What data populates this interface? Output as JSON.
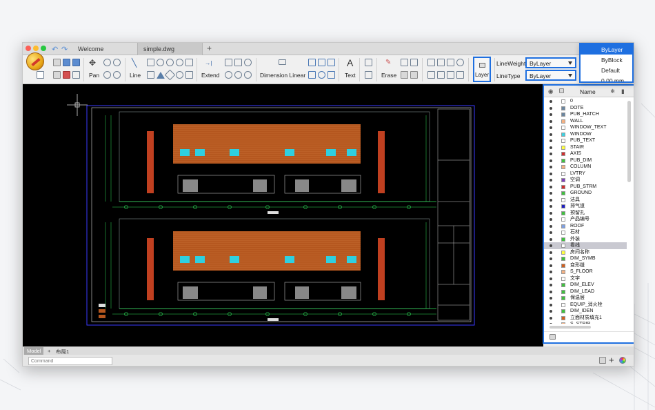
{
  "tabs": [
    {
      "label": "Welcome"
    },
    {
      "label": "simple.dwg"
    }
  ],
  "tab_add": "+",
  "ribbon": {
    "pan": "Pan",
    "line": "Line",
    "extend": "Extend",
    "dimension": "Dimension Linear",
    "text": "Text",
    "erase": "Erase",
    "layer": "Layer",
    "lineweight_label": "LineWeight",
    "linetype_label": "LineType",
    "lineweight_value": "ByLayer",
    "linetype_value": "ByLayer"
  },
  "dropdown": {
    "items": [
      "ByLayer",
      "ByBlock",
      "Default",
      "0.00 mm"
    ],
    "selected": "ByLayer"
  },
  "panel": {
    "name_header": "Name",
    "layers": [
      {
        "name": "0",
        "color": "#ffffff"
      },
      {
        "name": "DOTE",
        "color": "#6b86a0"
      },
      {
        "name": "PUB_HATCH",
        "color": "#6b86a0"
      },
      {
        "name": "WALL",
        "color": "#f4b183"
      },
      {
        "name": "WINDOW_TEXT",
        "color": "#ffffff"
      },
      {
        "name": "WINDOW",
        "color": "#40d0e0"
      },
      {
        "name": "PUB_TEXT",
        "color": "#ffffff"
      },
      {
        "name": "STAIR",
        "color": "#ffff40"
      },
      {
        "name": "AXIS",
        "color": "#d03030"
      },
      {
        "name": "PUB_DIM",
        "color": "#40c040"
      },
      {
        "name": "COLUMN",
        "color": "#f4b183"
      },
      {
        "name": "LVTRY",
        "color": "#ffffff"
      },
      {
        "name": "空调",
        "color": "#8040c0"
      },
      {
        "name": "PUB_STRM",
        "color": "#d03030"
      },
      {
        "name": "GROUND",
        "color": "#40c040"
      },
      {
        "name": "洁具",
        "color": "#ffffff"
      },
      {
        "name": "排气道",
        "color": "#2020c0"
      },
      {
        "name": "预留孔",
        "color": "#40c040"
      },
      {
        "name": "产品编号",
        "color": "#ffffff"
      },
      {
        "name": "ROOF",
        "color": "#80a0e0"
      },
      {
        "name": "石材",
        "color": "#ffffff"
      },
      {
        "name": "外装",
        "color": "#40c040"
      },
      {
        "name": "看线",
        "color": "#ffffff"
      },
      {
        "name": "房间名称",
        "color": "#ffff40"
      },
      {
        "name": "DIM_SYMB",
        "color": "#40c040"
      },
      {
        "name": "变形缝",
        "color": "#d06020"
      },
      {
        "name": "S_FLOOR",
        "color": "#f4b183"
      },
      {
        "name": "文字",
        "color": "#ffffff"
      },
      {
        "name": "DIM_ELEV",
        "color": "#40c040"
      },
      {
        "name": "DIM_LEAD",
        "color": "#40c040"
      },
      {
        "name": "保温层",
        "color": "#40c040"
      },
      {
        "name": "EQUIP_消火栓",
        "color": "#ffffff"
      },
      {
        "name": "DIM_IDEN",
        "color": "#40c040"
      },
      {
        "name": "立面材质填充1",
        "color": "#d06020"
      },
      {
        "name": "S_STRIP",
        "color": "#f4b183"
      }
    ]
  },
  "model_tabs": [
    "Model",
    "+",
    "布局1"
  ],
  "command_placeholder": "Command",
  "accent_color": "#1e6fe0"
}
